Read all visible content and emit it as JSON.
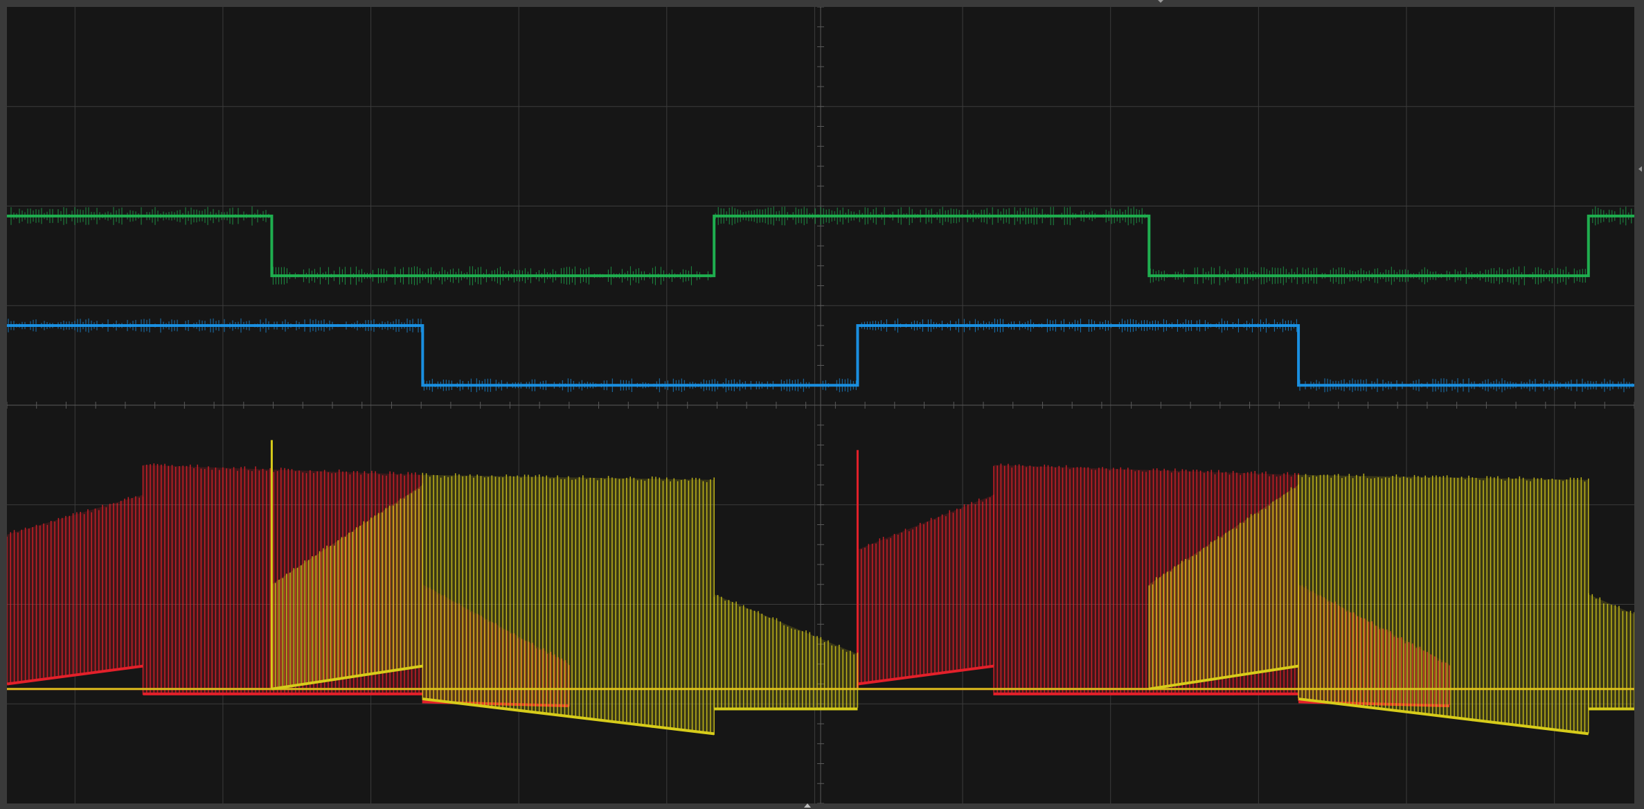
{
  "screen": {
    "background": "#161616",
    "frame_color": "#3a3a3a",
    "grid_color": "#3c3c3c",
    "axis_color": "#5a5a5a",
    "horizontal_divisions": 11,
    "vertical_divisions": 8,
    "has_split_view": true
  },
  "channels": [
    {
      "id": "green",
      "color": "#1fae4f",
      "pane": "upper"
    },
    {
      "id": "blue",
      "color": "#1a8fe0",
      "pane": "upper"
    },
    {
      "id": "red",
      "color": "#e3202a",
      "pane": "lower"
    },
    {
      "id": "yellow",
      "color": "#d7cc1a",
      "pane": "lower"
    }
  ],
  "chart_data": {
    "type": "line",
    "xlim": [
      0,
      11
    ],
    "ylim": [
      0,
      8
    ],
    "grid": true,
    "series": [
      {
        "id": "green",
        "color": "#1fae4f",
        "kind": "square",
        "levels": [
          1.9,
          1.3
        ],
        "transitions": [
          1.79,
          4.78,
          7.72,
          10.69
        ],
        "start_level": 0,
        "noise": 0.08
      },
      {
        "id": "blue",
        "color": "#1a8fe0",
        "kind": "square",
        "levels": [
          0.8,
          0.2
        ],
        "transitions": [
          2.81,
          5.75,
          8.73
        ],
        "start_level": 0,
        "noise": 0.06
      },
      {
        "id": "red",
        "color": "#e3202a",
        "kind": "pwm",
        "baseline": -2.85,
        "segments": [
          {
            "x0": 0.0,
            "x1": 0.92,
            "top0": -1.3,
            "top1": -0.9,
            "bot0": -2.8,
            "bot1": -2.62
          },
          {
            "x0": 0.92,
            "x1": 2.81,
            "top0": -0.6,
            "top1": -0.7,
            "bot0": -2.9,
            "bot1": -2.9
          },
          {
            "x0": 2.81,
            "x1": 3.8,
            "top0": -1.8,
            "top1": -2.6,
            "bot0": -2.98,
            "bot1": -3.02
          },
          {
            "x0": 5.75,
            "x1": 6.67,
            "top0": -1.45,
            "top1": -0.9,
            "bot0": -2.8,
            "bot1": -2.62
          },
          {
            "x0": 6.67,
            "x1": 8.73,
            "top0": -0.6,
            "top1": -0.7,
            "bot0": -2.9,
            "bot1": -2.9
          },
          {
            "x0": 8.73,
            "x1": 9.75,
            "top0": -1.8,
            "top1": -2.6,
            "bot0": -2.98,
            "bot1": -3.02
          }
        ],
        "spike_x": 5.75,
        "spike_top": -0.45
      },
      {
        "id": "yellow",
        "color": "#d7cc1a",
        "kind": "pwm",
        "baseline": -2.85,
        "segments": [
          {
            "x0": 1.79,
            "x1": 2.81,
            "top0": -1.8,
            "top1": -0.8,
            "bot0": -2.85,
            "bot1": -2.62
          },
          {
            "x0": 2.81,
            "x1": 4.78,
            "top0": -0.7,
            "top1": -0.75,
            "bot0": -2.95,
            "bot1": -3.3
          },
          {
            "x0": 4.78,
            "x1": 5.75,
            "top0": -1.9,
            "top1": -2.5,
            "bot0": -3.05,
            "bot1": -3.05
          },
          {
            "x0": 7.72,
            "x1": 8.73,
            "top0": -1.8,
            "top1": -0.8,
            "bot0": -2.85,
            "bot1": -2.62
          },
          {
            "x0": 8.73,
            "x1": 10.69,
            "top0": -0.7,
            "top1": -0.75,
            "bot0": -2.95,
            "bot1": -3.3
          },
          {
            "x0": 10.69,
            "x1": 11.0,
            "top0": -1.9,
            "top1": -2.1,
            "bot0": -3.05,
            "bot1": -3.05
          }
        ],
        "spike_x": 1.79,
        "spike_top": -0.35
      }
    ]
  }
}
